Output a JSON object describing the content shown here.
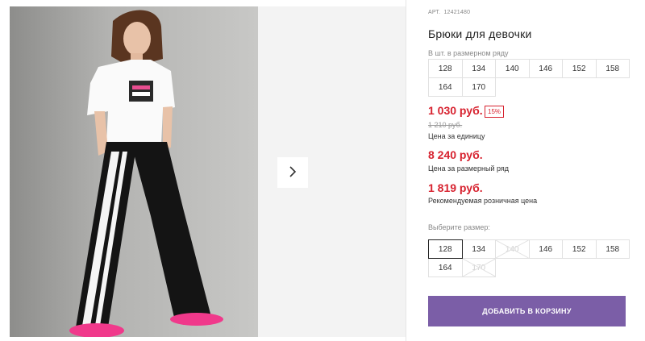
{
  "product": {
    "art_label": "АРТ.",
    "art_number": "12421480",
    "title": "Брюки для девочки"
  },
  "size_row": {
    "caption": "В шт. в размерном ряду",
    "sizes": [
      "128",
      "134",
      "140",
      "146",
      "152",
      "158",
      "164",
      "170"
    ]
  },
  "pricing": {
    "price": "1 030 руб.",
    "discount": "15%",
    "old_price": "1 210 руб.",
    "price_label": "Цена за единицу",
    "row_price": "8 240 руб.",
    "row_price_label": "Цена за размерный ряд",
    "recommended_price": "1 819 руб.",
    "recommended_label": "Рекомендуемая розничная цена"
  },
  "size_select": {
    "caption": "Выберите размер:",
    "selected": "128",
    "options": [
      {
        "label": "128",
        "state": "selected"
      },
      {
        "label": "134",
        "state": "available"
      },
      {
        "label": "140",
        "state": "disabled"
      },
      {
        "label": "146",
        "state": "available"
      },
      {
        "label": "152",
        "state": "available"
      },
      {
        "label": "158",
        "state": "available"
      },
      {
        "label": "164",
        "state": "available"
      },
      {
        "label": "170",
        "state": "disabled"
      }
    ]
  },
  "cart": {
    "add_label": "ДОБАВИТЬ В КОРЗИНУ"
  },
  "icons": {
    "gallery_next": "chevron-right-icon"
  },
  "colors": {
    "price_red": "#d7222f",
    "button_purple": "#7b5ea7"
  }
}
